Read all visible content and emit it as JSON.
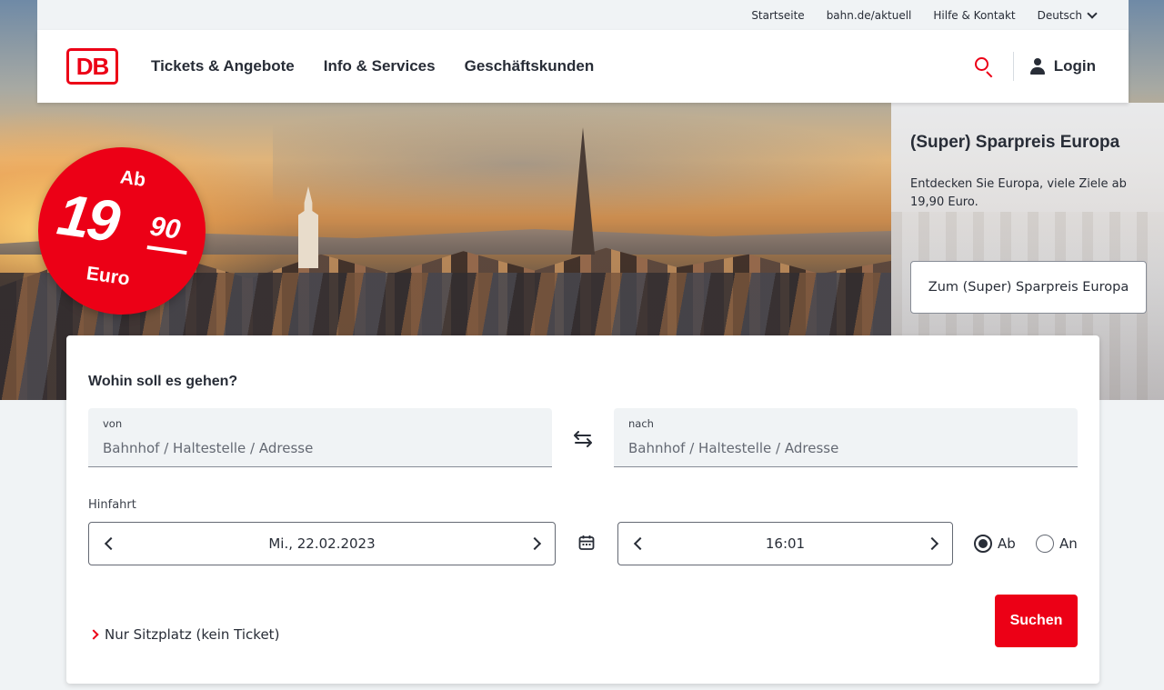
{
  "utility_nav": {
    "items": [
      "Startseite",
      "bahn.de/aktuell",
      "Hilfe & Kontakt"
    ],
    "language": "Deutsch"
  },
  "header": {
    "logo": "DB",
    "nav": [
      "Tickets & Angebote",
      "Info & Services",
      "Geschäftskunden"
    ],
    "login_label": "Login"
  },
  "badge": {
    "prefix": "Ab",
    "amount": "19",
    "cents": "90",
    "currency": "Euro"
  },
  "promo": {
    "title": "(Super) Sparpreis Europa",
    "description": "Entdecken Sie Europa, viele Ziele ab 19,90 Euro.",
    "button_label": "Zum (Super) Sparpreis Europa"
  },
  "booking": {
    "title": "Wohin soll es gehen?",
    "from": {
      "label": "von",
      "placeholder": "Bahnhof / Haltestelle / Adresse"
    },
    "to": {
      "label": "nach",
      "placeholder": "Bahnhof / Haltestelle / Adresse"
    },
    "outbound_label": "Hinfahrt",
    "date": "Mi., 22.02.2023",
    "time": "16:01",
    "radio_departure": "Ab",
    "radio_arrival": "An",
    "selected_radio": "Ab",
    "seat_only_link": "Nur Sitzplatz (kein Ticket)",
    "search_button": "Suchen"
  },
  "colors": {
    "brand_red": "#ec0016",
    "text": "#282d37",
    "field_bg": "#f0f3f5"
  }
}
